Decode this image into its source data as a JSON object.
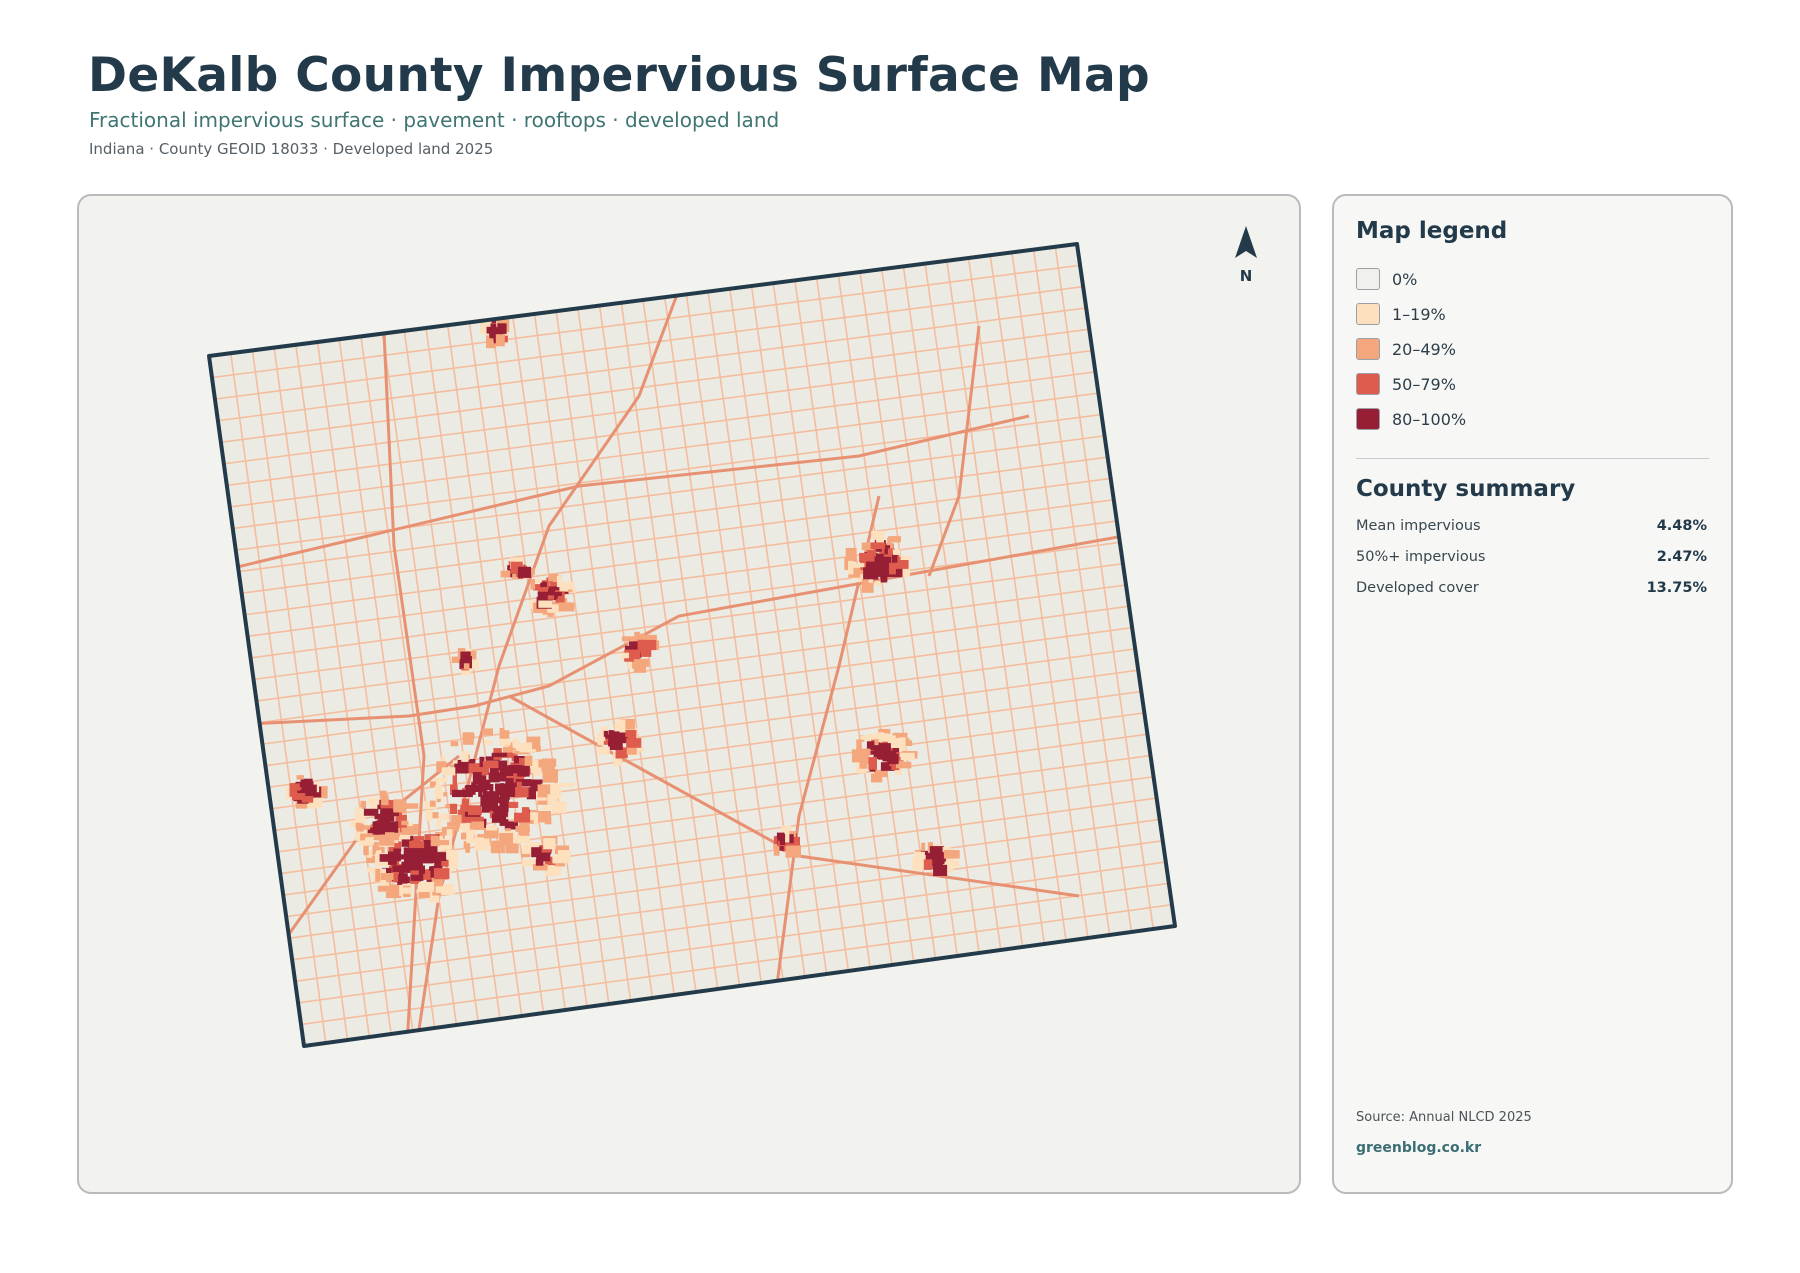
{
  "header": {
    "title": "DeKalb County Impervious Surface Map",
    "subtitle": "Fractional impervious surface · pavement · rooftops · developed land",
    "meta": "Indiana · County GEOID 18033 · Developed land 2025"
  },
  "map": {
    "north_label": "N",
    "north_icon": "north-arrow-icon",
    "background_color": "#f2f2ef",
    "land_color": "#ebebe3",
    "boundary_color": "#233a4a"
  },
  "legend": {
    "title": "Map legend",
    "items": [
      {
        "label": "0%",
        "color": "#f0f0ec"
      },
      {
        "label": "1–19%",
        "color": "#fde0bd"
      },
      {
        "label": "20–49%",
        "color": "#f4a67c"
      },
      {
        "label": "50–79%",
        "color": "#dd5c4d"
      },
      {
        "label": "80–100%",
        "color": "#961f35"
      }
    ]
  },
  "summary": {
    "title": "County summary",
    "stats": [
      {
        "label": "Mean impervious",
        "value": "4.48%"
      },
      {
        "label": "50%+ impervious",
        "value": "2.47%"
      },
      {
        "label": "Developed cover",
        "value": "13.75%"
      }
    ]
  },
  "footer": {
    "source": "Source: Annual NLCD 2025",
    "credit": "greenblog.co.kr"
  }
}
